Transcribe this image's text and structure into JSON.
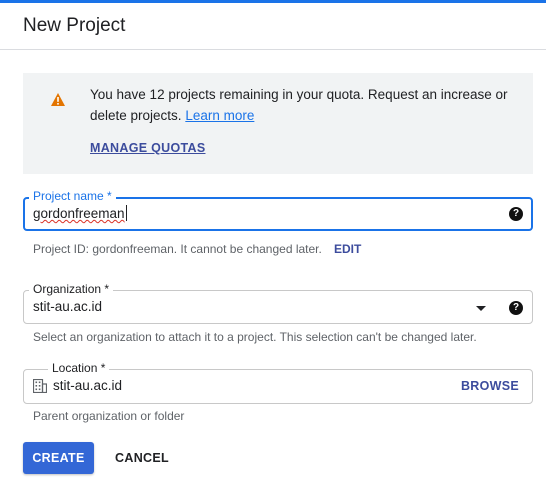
{
  "colors": {
    "accent": "#1a73e8",
    "primary_button": "#3367d6",
    "warning": "#e37400",
    "banner_bg": "#f1f3f4"
  },
  "header": {
    "title": "New Project"
  },
  "quota_banner": {
    "icon": "warning-icon",
    "text": "You have 12 projects remaining in your quota. Request an increase or delete projects.",
    "learn_more": "Learn more",
    "manage_quotas": "MANAGE QUOTAS"
  },
  "project_name": {
    "label": "Project name *",
    "value": "gordonfreeman",
    "help_icon": "help-icon",
    "hint": "Project ID: gordonfreeman. It cannot be changed later.",
    "edit": "EDIT"
  },
  "organization": {
    "label": "Organization *",
    "value": "stit-au.ac.id",
    "dropdown_icon": "dropdown-arrow-icon",
    "help_icon": "help-icon",
    "hint": "Select an organization to attach it to a project. This selection can't be changed later."
  },
  "location": {
    "label": "Location *",
    "value": "stit-au.ac.id",
    "icon": "building-icon",
    "browse": "BROWSE",
    "hint": "Parent organization or folder"
  },
  "actions": {
    "create": "CREATE",
    "cancel": "CANCEL"
  }
}
